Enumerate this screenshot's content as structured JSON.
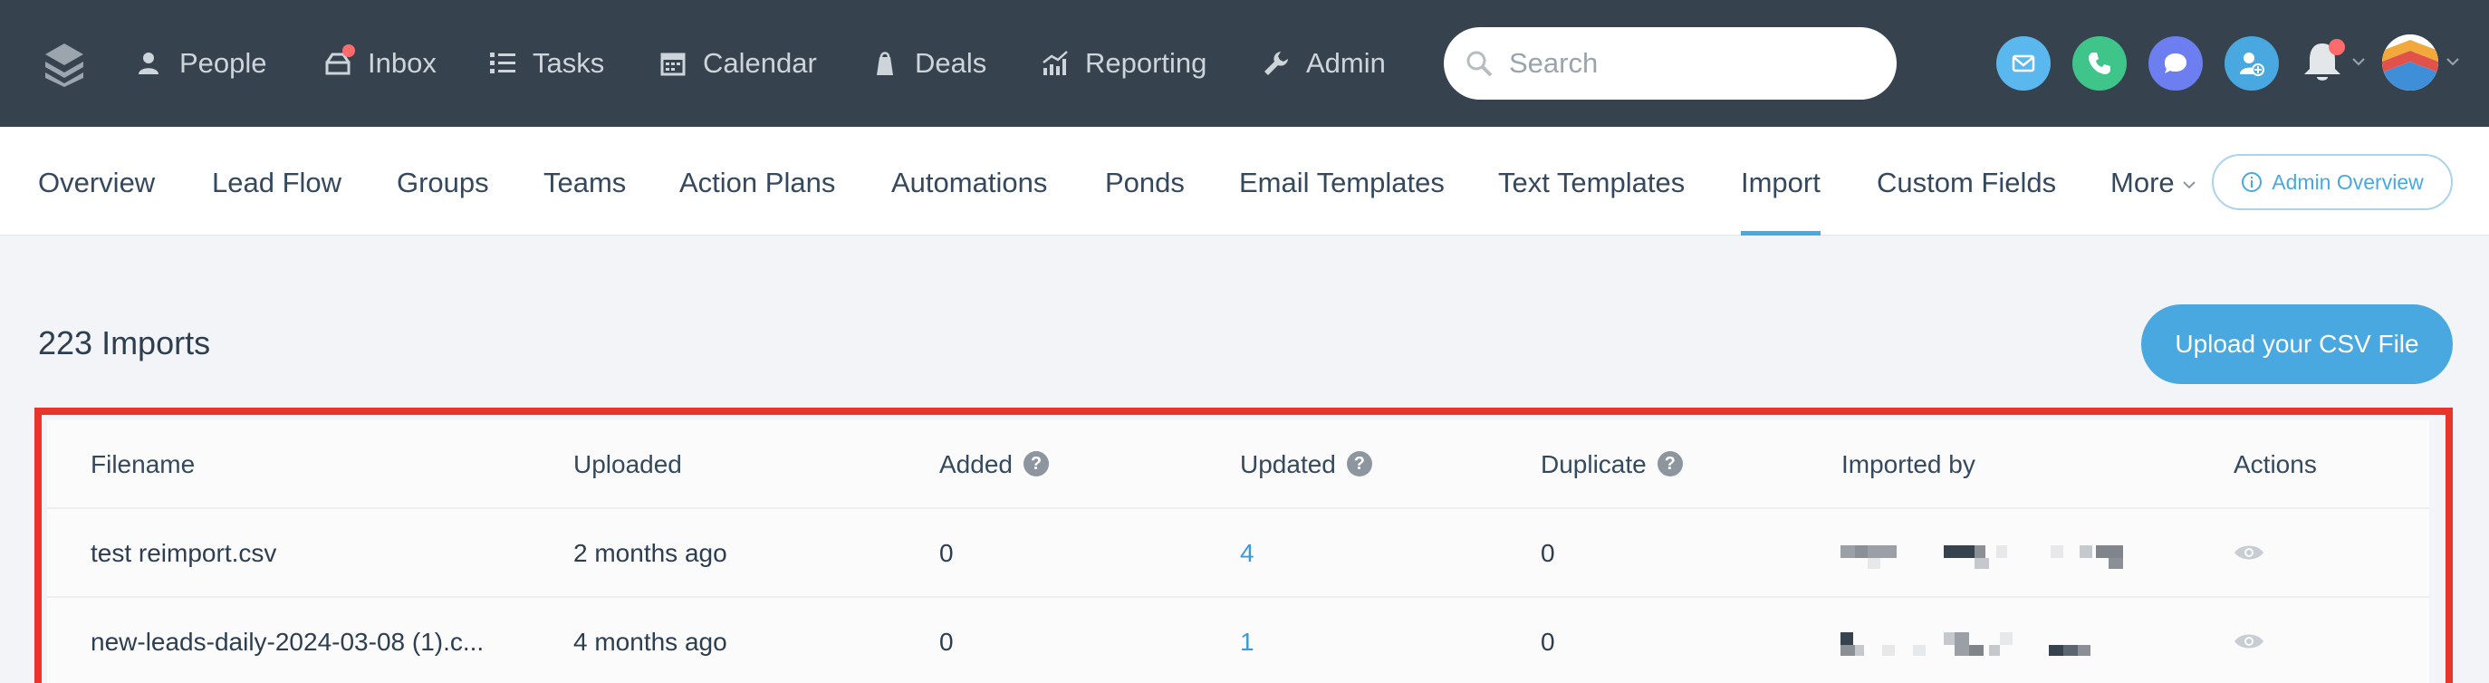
{
  "nav": {
    "items": [
      {
        "label": "People",
        "icon": "person-icon"
      },
      {
        "label": "Inbox",
        "icon": "inbox-icon"
      },
      {
        "label": "Tasks",
        "icon": "tasks-list-icon"
      },
      {
        "label": "Calendar",
        "icon": "calendar-icon"
      },
      {
        "label": "Deals",
        "icon": "deals-tag-icon"
      },
      {
        "label": "Reporting",
        "icon": "reporting-chart-icon"
      },
      {
        "label": "Admin",
        "icon": "wrench-icon"
      }
    ],
    "search_placeholder": "Search"
  },
  "subnav": {
    "items": [
      "Overview",
      "Lead Flow",
      "Groups",
      "Teams",
      "Action Plans",
      "Automations",
      "Ponds",
      "Email Templates",
      "Text Templates",
      "Import",
      "Custom Fields",
      "More"
    ],
    "active": "Import",
    "admin_overview": "Admin Overview"
  },
  "imports": {
    "title": "223 Imports",
    "upload_label": "Upload your CSV File",
    "columns": [
      "Filename",
      "Uploaded",
      "Added",
      "Updated",
      "Duplicate",
      "Imported by",
      "Actions"
    ],
    "help_mark": "?",
    "rows": [
      {
        "filename": "test reimport.csv",
        "uploaded": "2 months ago",
        "added": "0",
        "updated": "4",
        "duplicate": "0"
      },
      {
        "filename": "new-leads-daily-2024-03-08 (1).c...",
        "uploaded": "4 months ago",
        "added": "0",
        "updated": "1",
        "duplicate": "0"
      }
    ]
  },
  "colors": {
    "topbar": "#36434f",
    "accent": "#4aa8e0",
    "highlight": "#e8342a",
    "email_circle": "#5bb8ef",
    "phone_circle": "#3fc48a",
    "chat_circle": "#6d7ff0",
    "add_contact_circle": "#4aa8e0"
  }
}
